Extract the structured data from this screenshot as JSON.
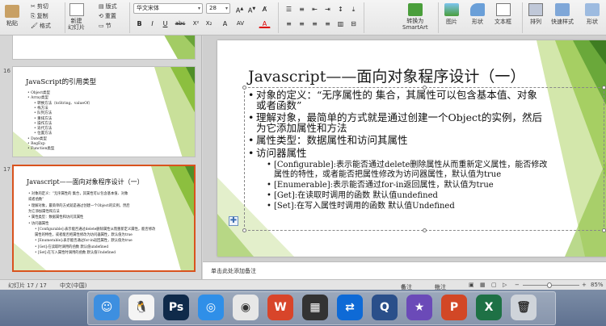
{
  "ribbon": {
    "paste": "粘贴",
    "cut": "剪切",
    "copy": "复制",
    "format": "格式",
    "new_slide": "新建\n幻灯片",
    "layout": "版式",
    "reset": "重置",
    "section": "节",
    "font_name": "华文宋体",
    "font_size": "28",
    "convert_smartart": "转换为\nSmartArt",
    "picture": "图片",
    "shape": "形状",
    "textbox": "文本框",
    "arrange": "排列",
    "quick_styles": "快速样式",
    "shape_fill": "形状"
  },
  "thumbnails": [
    {
      "number": "",
      "partial": true
    },
    {
      "number": "16",
      "title": "JavaScript的引用类型",
      "lines": [
        {
          "level": 1,
          "text": "• Object类型"
        },
        {
          "level": 1,
          "text": "• Array类型"
        },
        {
          "level": 2,
          "text": "• 转换方法（toString、valueOf）"
        },
        {
          "level": 2,
          "text": "• 栈方法"
        },
        {
          "level": 2,
          "text": "• 队列方法"
        },
        {
          "level": 2,
          "text": "• 重排方法"
        },
        {
          "level": 2,
          "text": "• 操作方法"
        },
        {
          "level": 2,
          "text": "• 迭代方法"
        },
        {
          "level": 2,
          "text": "• 位置方法"
        },
        {
          "level": 1,
          "text": "• Date类型"
        },
        {
          "level": 1,
          "text": "• RegExp"
        },
        {
          "level": 1,
          "text": "• Function类型"
        }
      ]
    },
    {
      "number": "17",
      "title": "Javascript——面向对象程序设计（一）",
      "lines": [
        {
          "level": 1,
          "text": "• 对象的定义：“无序属性的 集合，其属性可以包含基本值、对象"
        },
        {
          "level": 1,
          "text": "  或者函数”"
        },
        {
          "level": 1,
          "text": "• 理解对象，最简单的方式就是通过创建一个Object的实例，然后"
        },
        {
          "level": 1,
          "text": "  为它添加属性和方法"
        },
        {
          "level": 1,
          "text": "• 属性类型：数据属性和访问其属性"
        },
        {
          "level": 1,
          "text": "• 访问器属性"
        },
        {
          "level": 2,
          "text": "• [Configurable]:表示能否通过delete删除属性从而重新定义属性，能否修改"
        },
        {
          "level": 2,
          "text": "  属性的特性，或者能否把属性修改为访问器属性，默认值为true"
        },
        {
          "level": 2,
          "text": "• [Enumerable]:表示能否通过for-in返回属性，默认值为true"
        },
        {
          "level": 2,
          "text": "• [Get]:在读取时调用的函数 默认值undefined"
        },
        {
          "level": 2,
          "text": "• [Set]:在写入属性时调用的函数 默认值Undefined"
        }
      ]
    }
  ],
  "slide": {
    "title": "Javascript——面向对象程序设计（一）",
    "bullets": [
      {
        "level": 1,
        "lines": [
          "对象的定义：“无序属性的 集合，其属性可以包含基本值、对象",
          "或者函数”"
        ]
      },
      {
        "level": 1,
        "lines": [
          "理解对象，最简单的方式就是通过创建一个Object的实例，然后",
          "为它添加属性和方法"
        ]
      },
      {
        "level": 1,
        "lines": [
          "属性类型：数据属性和访问其属性"
        ]
      },
      {
        "level": 1,
        "lines": [
          "访问器属性"
        ]
      },
      {
        "level": 2,
        "lines": [
          "[Configurable]:表示能否通过delete删除属性从而重新定义属性，能否修改",
          "属性的特性，或者能否把属性修改为访问器属性，默认值为true"
        ]
      },
      {
        "level": 2,
        "lines": [
          "[Enumerable]:表示能否通过for-in返回属性，默认值为true"
        ]
      },
      {
        "level": 2,
        "lines": [
          "[Get]:在读取时调用的函数 默认值undefined"
        ]
      },
      {
        "level": 2,
        "lines": [
          "[Set]:在写入属性时调用的函数 默认值Undefined"
        ]
      }
    ]
  },
  "notes": {
    "placeholder": "单击此处添加备注"
  },
  "status": {
    "slide_count": "幻灯片 17 / 17",
    "language": "中文(中国)",
    "notes_btn": "备注",
    "comments_btn": "批注",
    "zoom": "85%"
  },
  "dock": [
    {
      "name": "finder-icon",
      "color": "#3d8fe0",
      "glyph": "☺"
    },
    {
      "name": "qq-icon",
      "color": "#f4f4f4",
      "glyph": "🐧"
    },
    {
      "name": "photoshop-icon",
      "color": "#0f2a4a",
      "glyph": "Ps"
    },
    {
      "name": "safari-icon",
      "color": "#2f8fe8",
      "glyph": "◎"
    },
    {
      "name": "chrome-icon",
      "color": "#e7e7e7",
      "glyph": "◉"
    },
    {
      "name": "wps-icon",
      "color": "#d8452a",
      "glyph": "W"
    },
    {
      "name": "video-icon",
      "color": "#333333",
      "glyph": "▦"
    },
    {
      "name": "teamviewer-icon",
      "color": "#0e6ad6",
      "glyph": "⇄"
    },
    {
      "name": "quicktime-icon",
      "color": "#2a4f8a",
      "glyph": "Q"
    },
    {
      "name": "imovie-icon",
      "color": "#6b4ab8",
      "glyph": "★"
    },
    {
      "name": "powerpoint-icon",
      "color": "#d24726",
      "glyph": "P"
    },
    {
      "name": "excel-icon",
      "color": "#1e7145",
      "glyph": "X"
    },
    {
      "name": "trash-icon",
      "color": "#cfd4da",
      "glyph": "🗑"
    }
  ]
}
